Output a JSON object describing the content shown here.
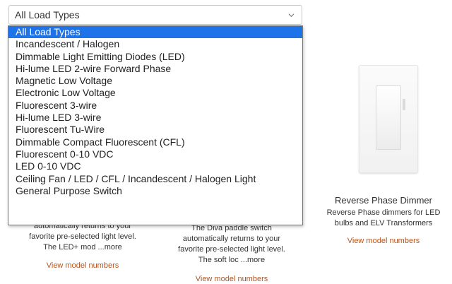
{
  "select": {
    "value": "All Load Types",
    "icon": "chevron-down-icon"
  },
  "dropdown": {
    "options": [
      "All Load Types",
      "Incandescent / Halogen",
      "Dimmable Light Emitting Diodes (LED)",
      "Hi-lume LED 2-wire Forward Phase",
      "Magnetic Low Voltage",
      "Electronic Low Voltage",
      "Fluorescent 3-wire",
      "Hi-lume LED 3-wire",
      "Fluorescent Tu-Wire",
      "Dimmable Compact Fluorescent (CFL)",
      "Fluorescent 0-10 VDC",
      "LED 0-10 VDC",
      "Ceiling Fan / LED / CFL / Incandescent / Halogen Light",
      "General Purpose Switch"
    ],
    "selected_index": 0,
    "highlight_color": "#1e73e8"
  },
  "cards": {
    "left": {
      "line1": "automatically returns to your",
      "line2": "favorite pre-selected light level.",
      "line3": "The LED+ mod ...more",
      "link": "View model numbers"
    },
    "middle": {
      "line1": "The Diva paddle switch",
      "line2": "automatically returns to your",
      "line3": "favorite pre-selected light level.",
      "line4": "The soft loc ...more",
      "link": "View model numbers"
    },
    "right": {
      "title": "Reverse Phase Dimmer",
      "line1": "Reverse Phase dimmers for LED",
      "line2": "bulbs and ELV Transformers",
      "link": "View model numbers"
    }
  },
  "colors": {
    "link": "#b3541e",
    "text": "#333333"
  }
}
